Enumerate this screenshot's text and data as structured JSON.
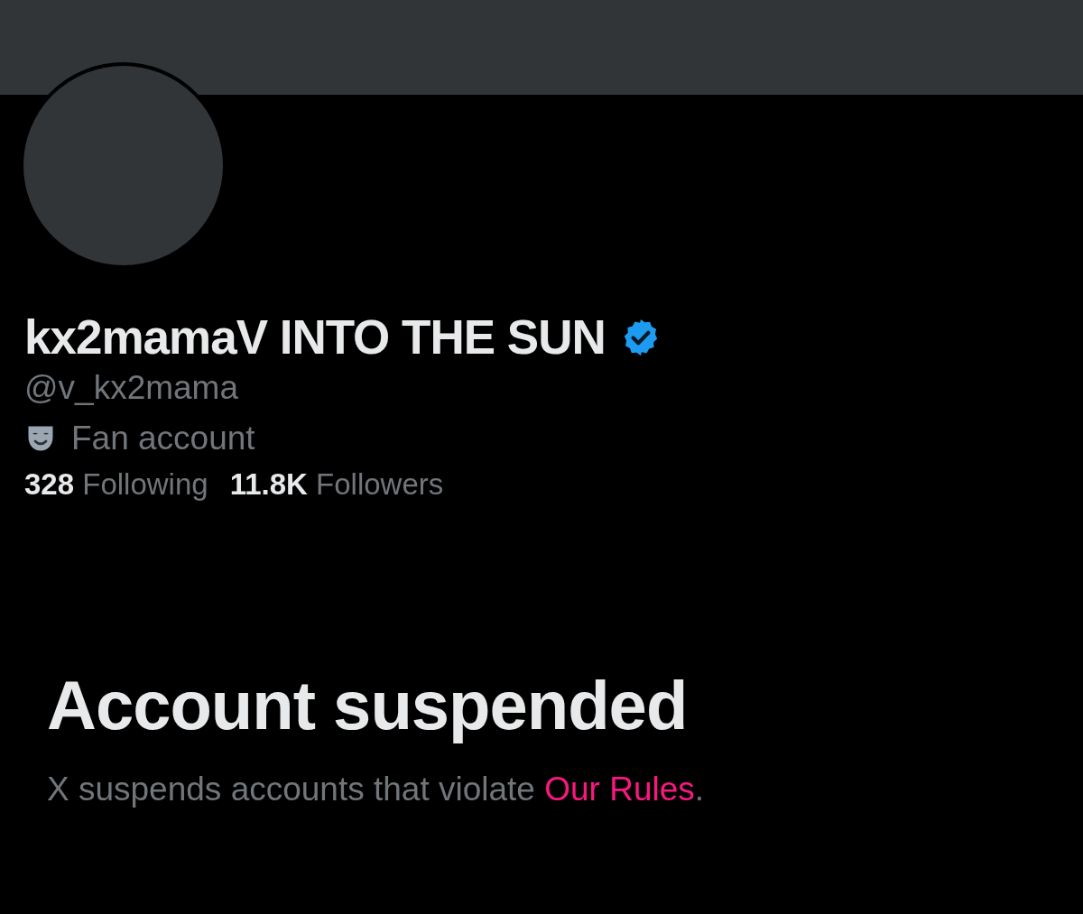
{
  "profile": {
    "display_name": "kx2mamaV INTO THE SUN",
    "verified": true,
    "handle": "@v_kx2mama",
    "category": "Fan account"
  },
  "stats": [
    {
      "count": "328",
      "label": "Following"
    },
    {
      "count": "11.8K",
      "label": "Followers"
    }
  ],
  "notice": {
    "title": "Account suspended",
    "text": "X suspends accounts that violate ",
    "link": "Our Rules",
    "end": "."
  }
}
